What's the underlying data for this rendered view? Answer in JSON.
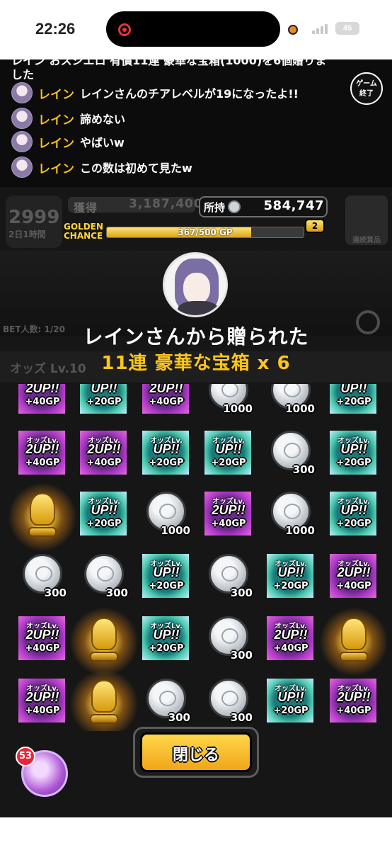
{
  "status_bar": {
    "time": "22:26",
    "battery": "45"
  },
  "chat": {
    "partial_line_1": "レイン  おスシエロ 有償11連 豪華な宝箱(1000)を6個贈りま",
    "partial_line_2": "した",
    "messages": [
      {
        "name": "レイン",
        "text": "レインさんのチアレベルが19になったよ!!"
      },
      {
        "name": "レイン",
        "text": "諦めない"
      },
      {
        "name": "レイン",
        "text": "やばいw"
      },
      {
        "name": "レイン",
        "text": "この数は初めて見たw"
      }
    ]
  },
  "game_end_button": {
    "line1": "ゲーム",
    "line2": "終了"
  },
  "header": {
    "rank_value": "2999",
    "rank_sub": "2日1時間",
    "bg_possess_label": "獲得",
    "bg_possess_value": "3,187,400",
    "holding_label": "所持",
    "holding_value": "584,747",
    "golden_line1": "GOLDEN",
    "golden_line2": "CHANCE",
    "gp_text": "367/500 GP",
    "gp_progress": 0.734,
    "gp_level": "2",
    "reward_label": "連続賞品"
  },
  "background": {
    "bet_count": "BET人数: 1/20",
    "odds_bar_text": "オッズ Lv.10"
  },
  "gift": {
    "title": "レインさんから贈られた",
    "item": "11連 豪華な宝箱 x 6"
  },
  "rewards": {
    "odds_label": "オッズLv.",
    "up2": "2UP!!",
    "up1": "UP!!",
    "gp40": "+40GP",
    "gp20": "+20GP",
    "coin_300": "300",
    "coin_1000": "1000"
  },
  "close_button": "閉じる",
  "emote_count": "53",
  "colors": {
    "accent_gold": "#ffc61a",
    "chat_name": "#f4c21c",
    "background": "#0c0c0c"
  }
}
